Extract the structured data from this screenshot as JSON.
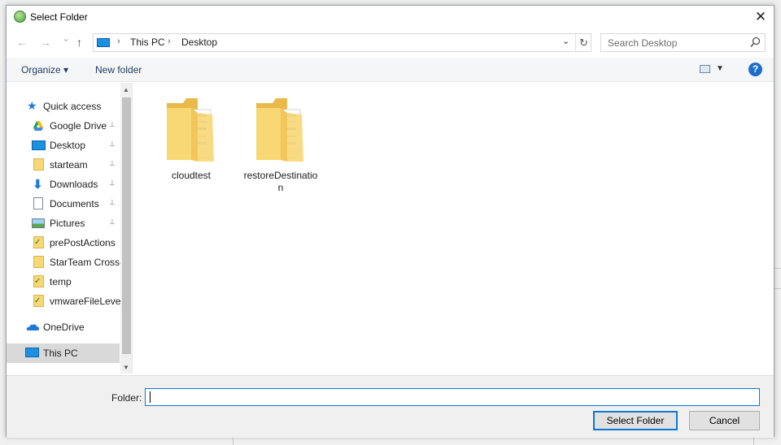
{
  "window": {
    "title": "Select Folder",
    "close_glyph": "✕"
  },
  "navbar": {
    "back_glyph": "←",
    "forward_glyph": "→",
    "recent_glyph": "⌄",
    "up_glyph": "↑",
    "breadcrumb": [
      "This PC",
      "Desktop"
    ],
    "separator": "›",
    "dropdown_glyph": "⌄",
    "refresh_glyph": "↻",
    "search_placeholder": "Search Desktop"
  },
  "toolbar": {
    "organize_label": "Organize ▾",
    "new_folder_label": "New folder",
    "view_dropdown_glyph": "▼",
    "help_glyph": "?"
  },
  "sidebar": {
    "items": [
      {
        "label": "Quick access",
        "icon": "star-icon",
        "pinned": false,
        "level": 0
      },
      {
        "label": "Google Drive",
        "icon": "google-drive-icon",
        "pinned": true,
        "level": 1
      },
      {
        "label": "Desktop",
        "icon": "desktop-icon",
        "pinned": true,
        "level": 1
      },
      {
        "label": "starteam",
        "icon": "folder-icon",
        "pinned": true,
        "level": 1
      },
      {
        "label": "Downloads",
        "icon": "download-icon",
        "pinned": true,
        "level": 1
      },
      {
        "label": "Documents",
        "icon": "documents-icon",
        "pinned": true,
        "level": 1
      },
      {
        "label": "Pictures",
        "icon": "pictures-icon",
        "pinned": true,
        "level": 1
      },
      {
        "label": "prePostActions",
        "icon": "folder-check-icon",
        "pinned": false,
        "level": 1
      },
      {
        "label": "StarTeam Cross-",
        "icon": "folder-icon",
        "pinned": false,
        "level": 1
      },
      {
        "label": "temp",
        "icon": "folder-check-icon",
        "pinned": false,
        "level": 1
      },
      {
        "label": "vmwareFileLevel",
        "icon": "folder-check-icon",
        "pinned": false,
        "level": 1
      },
      {
        "label": "OneDrive",
        "icon": "onedrive-icon",
        "pinned": false,
        "level": 0
      },
      {
        "label": "This PC",
        "icon": "this-pc-icon",
        "pinned": false,
        "level": 0,
        "selected": true
      }
    ],
    "pin_glyph": "📌"
  },
  "content": {
    "folders": [
      {
        "name": "cloudtest"
      },
      {
        "name": "restoreDestination"
      }
    ]
  },
  "footer": {
    "folder_label": "Folder:",
    "folder_value": "",
    "select_button": "Select Folder",
    "cancel_button": "Cancel"
  },
  "colors": {
    "accent": "#0a78d7",
    "folder": "#f8d775",
    "selected": "#d9d9d9"
  }
}
